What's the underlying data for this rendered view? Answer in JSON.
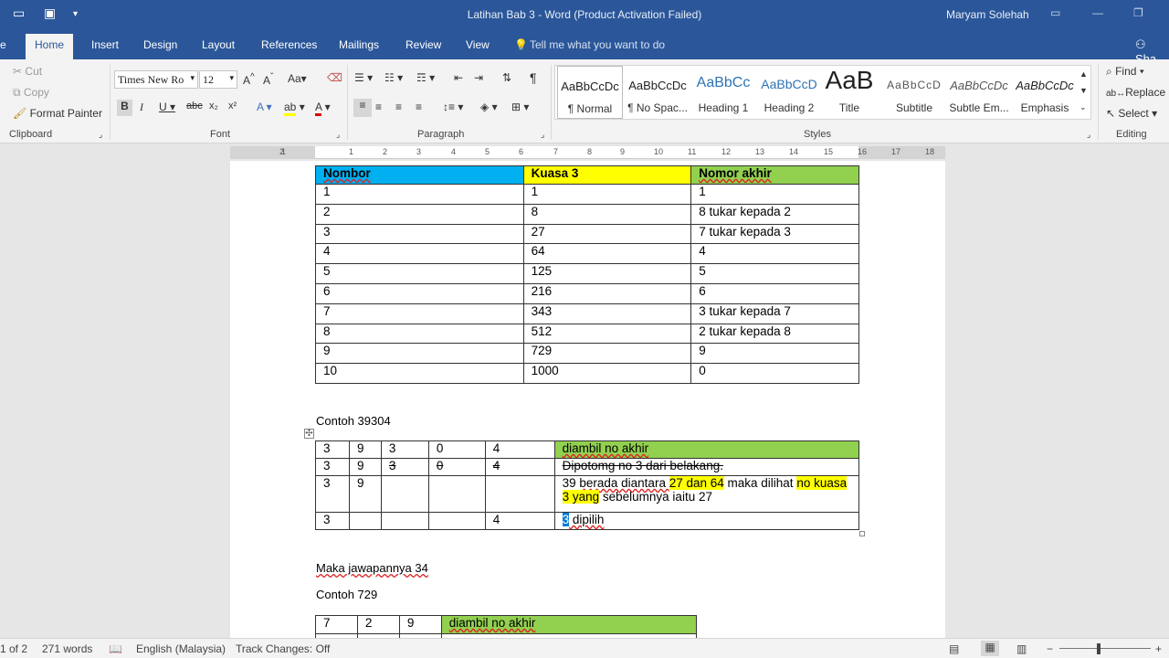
{
  "window": {
    "title": "Latihan Bab 3 - Word (Product Activation Failed)",
    "user": "Maryam Solehah"
  },
  "tabs": [
    "Home",
    "Insert",
    "Design",
    "Layout",
    "References",
    "Mailings",
    "Review",
    "View"
  ],
  "tell_me": "Tell me what you want to do",
  "share": "Sha",
  "ribbon": {
    "clipboard": {
      "label": "Clipboard",
      "cut": "Cut",
      "copy": "Copy",
      "format_painter": "Format Painter"
    },
    "font": {
      "label": "Font",
      "name": "Times New Ro",
      "size": "12"
    },
    "paragraph": {
      "label": "Paragraph"
    },
    "styles": {
      "label": "Styles",
      "items": [
        {
          "preview": "AaBbCcDc",
          "name": "¶ Normal"
        },
        {
          "preview": "AaBbCcDc",
          "name": "¶ No Spac..."
        },
        {
          "preview": "AaBbCc",
          "name": "Heading 1"
        },
        {
          "preview": "AaBbCcD",
          "name": "Heading 2"
        },
        {
          "preview": "AaB",
          "name": "Title"
        },
        {
          "preview": "AaBbCcD",
          "name": "Subtitle"
        },
        {
          "preview": "AaBbCcDc",
          "name": "Subtle Em..."
        },
        {
          "preview": "AaBbCcDc",
          "name": "Emphasis"
        }
      ]
    },
    "editing": {
      "label": "Editing",
      "find": "Find",
      "replace": "Replace",
      "select": "Select"
    }
  },
  "ruler": {
    "labels": [
      "2",
      "1",
      "1",
      "2",
      "3",
      "4",
      "5",
      "6",
      "7",
      "8",
      "9",
      "10",
      "11",
      "12",
      "13",
      "14",
      "15",
      "16",
      "17",
      "18"
    ]
  },
  "table1": {
    "headers": [
      "Nombor",
      "Kuasa 3",
      "Nomor akhir"
    ],
    "rows": [
      [
        "1",
        "1",
        "1"
      ],
      [
        "2",
        "8",
        "8 tukar kepada 2"
      ],
      [
        "3",
        "27",
        "7 tukar kepada 3"
      ],
      [
        "4",
        "64",
        "4"
      ],
      [
        "5",
        "125",
        "5"
      ],
      [
        "6",
        "216",
        "6"
      ],
      [
        "7",
        "343",
        "3 tukar kepada 7"
      ],
      [
        "8",
        "512",
        "2 tukar kepada 8"
      ],
      [
        "9",
        "729",
        "9"
      ],
      [
        "10",
        "1000",
        "0"
      ]
    ],
    "colors": {
      "h1": "#00b0f0",
      "h2": "#ffff00",
      "h3": "#92d050"
    }
  },
  "contoh1": "Contoh 39304",
  "table2": {
    "row1": [
      "3",
      "9",
      "3",
      "0",
      "4",
      "diambil no akhir"
    ],
    "row2": [
      "3",
      "9",
      "3",
      "0",
      "4",
      "Dipotomg no 3 dari belakang."
    ],
    "row3": {
      "c1": "3",
      "c2": "9",
      "t1": "39 ",
      "t2": "berada diantara ",
      "t3": "27 dan 64",
      "t4": " maka dilihat ",
      "t5": "no kuasa 3 yang",
      "t6": " sebelumnya iaitu 27"
    },
    "row4": {
      "c1": "3",
      "c5": "4",
      "sel": "3",
      "rest": " dipilih"
    }
  },
  "maka": "Maka jawapannya 34",
  "contoh2": "Contoh 729",
  "table3": {
    "row1": [
      "7",
      "2",
      "9",
      "diambil no akhir"
    ]
  },
  "status": {
    "page": "1 of 2",
    "words": "271 words",
    "language": "English (Malaysia)",
    "track": "Track Changes: Off"
  }
}
